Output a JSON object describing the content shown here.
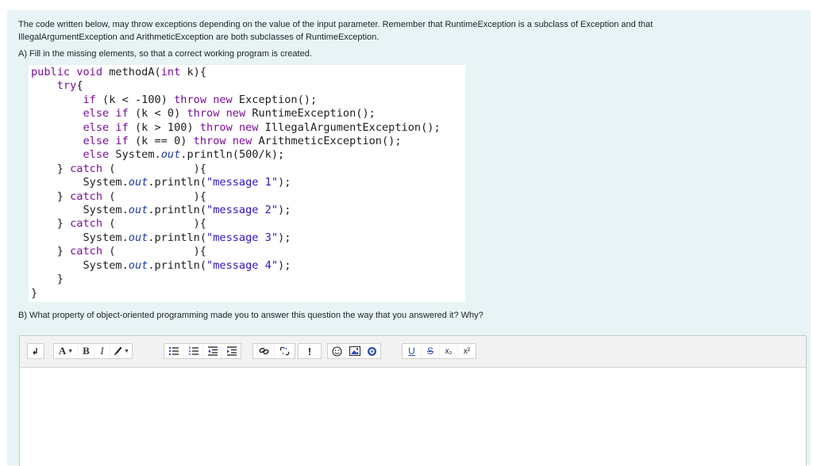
{
  "question": {
    "intro_line1": "The code written below, may throw exceptions depending on the value of the input parameter.  Remember that RuntimeException is a subclass of Exception and that",
    "intro_line2": "IllegalArgumentException and ArithmeticException are both subclasses of RuntimeException.",
    "part_a": "A) Fill in the missing elements, so that a correct working program is created.",
    "part_b": "B) What property of object-oriented programming made you to answer this question the way that you answered it? Why?"
  },
  "code": {
    "tokens": {
      "public": "public",
      "void": "void",
      "int": "int",
      "try": "try",
      "if": "if",
      "else": "else",
      "throw": "throw",
      "new": "new",
      "catch": "catch",
      "out": "out"
    },
    "method_name": "methodA(",
    "param": " k){",
    "brace_open": "{",
    "cond1": " (k < -100) ",
    "exc1": " Exception();",
    "cond2": " (k < 0) ",
    "exc2": " RuntimeException();",
    "cond3": " (k > 100) ",
    "exc3": " IllegalArgumentException();",
    "cond4": " (k == 0) ",
    "exc4": " ArithmeticException();",
    "else_print_pre": " System.",
    "else_print_post": ".println(500/k);",
    "catch_close": "} ",
    "catch_blank": " (            ){",
    "sys": "System.",
    "println_open": ".println(",
    "msg1": "\"message 1\"",
    "msg2": "\"message 2\"",
    "msg3": "\"message 3\"",
    "msg4": "\"message 4\"",
    "println_close": ");",
    "close_try": "}",
    "close_method": "}"
  },
  "toolbar": {
    "bold": "B",
    "italic": "I",
    "font_color": "A",
    "underline": "U",
    "strike": "S",
    "subscript": "x₂",
    "superscript": "x²",
    "exclamation": "!"
  }
}
